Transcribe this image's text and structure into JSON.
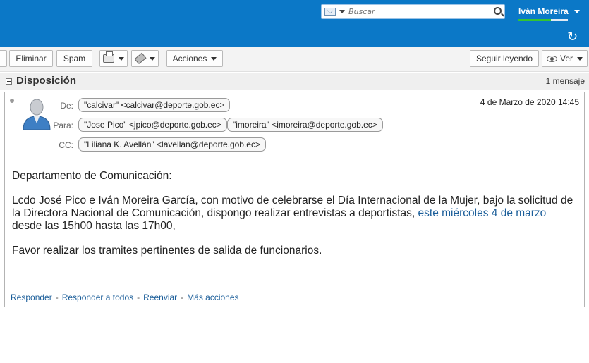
{
  "header": {
    "search_placeholder": "Buscar",
    "user_name": "Iván Moreira",
    "quota_fraction": 0.65,
    "refresh_glyph": "↻"
  },
  "toolbar": {
    "eliminar": "Eliminar",
    "spam": "Spam",
    "acciones": "Acciones",
    "seguir_leyendo": "Seguir leyendo",
    "ver": "Ver"
  },
  "conversation": {
    "subject": "Disposición",
    "count": "1 mensaje"
  },
  "message": {
    "date": "4 de Marzo de 2020 14:45",
    "from_label": "De:",
    "to_label": "Para:",
    "cc_label": "CC:",
    "from": "\"calcivar\" <calcivar@deporte.gob.ec>",
    "to": [
      "\"Jose Pico\" <jpico@deporte.gob.ec>",
      "\"imoreira\" <imoreira@deporte.gob.ec>"
    ],
    "cc": [
      "\"Liliana K. Avellán\" <lavellan@deporte.gob.ec>"
    ],
    "greeting": "Departamento de Comunicación:",
    "para1_before": "Lcdo José Pico e Iván Moreira García, con motivo de celebrarse el Día Internacional de la Mujer, bajo la solicitud de la Directora Nacional de Comunicación, dispongo realizar entrevistas a deportistas, ",
    "para1_link1": "este miércoles",
    "para1_space": " ",
    "para1_link2": "4 de marzo",
    "para1_after": " desde las 15h00 hasta las 17h00,",
    "para2": "Favor realizar los tramites pertinentes de salida de funcionarios.",
    "actions": {
      "reply": "Responder",
      "reply_all": "Responder a todos",
      "forward": "Reenviar",
      "more": "Más acciones",
      "separator": "-"
    }
  },
  "colors": {
    "topbar": "#0b78c7",
    "link": "#1a5d99",
    "quota": "#33c433"
  },
  "icons": [
    "mail-icon",
    "search-icon",
    "refresh-icon",
    "print-icon",
    "tag-icon",
    "eye-icon",
    "avatar-icon",
    "collapse-icon"
  ]
}
